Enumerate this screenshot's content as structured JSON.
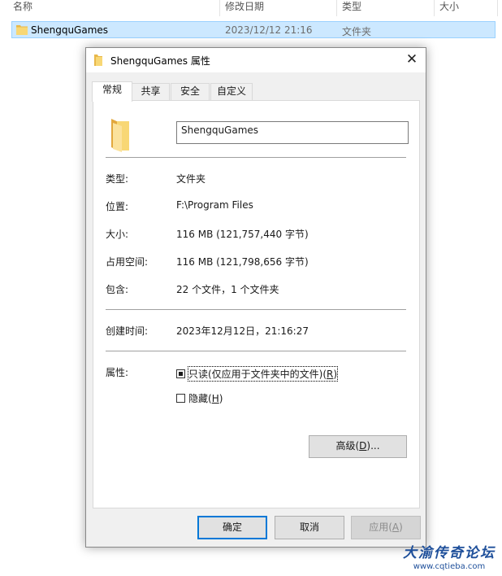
{
  "explorer": {
    "columns": [
      "名称",
      "修改日期",
      "类型",
      "大小"
    ],
    "row": {
      "name": "ShengquGames",
      "date": "2023/12/12 21:16",
      "type": "文件夹",
      "icon": "folder-icon"
    }
  },
  "dialog": {
    "title": "ShengquGames 属性",
    "close_glyph": "✕",
    "tabs": [
      "常规",
      "共享",
      "安全",
      "自定义"
    ],
    "active_tab": "常规",
    "name_value": "ShengquGames",
    "fields": [
      {
        "label": "类型:",
        "value": "文件夹"
      },
      {
        "label": "位置:",
        "value": "F:\\Program Files"
      },
      {
        "label": "大小:",
        "value": "116 MB (121,757,440 字节)"
      },
      {
        "label": "占用空间:",
        "value": "116 MB (121,798,656 字节)"
      },
      {
        "label": "包含:",
        "value": "22 个文件，1 个文件夹"
      }
    ],
    "created": {
      "label": "创建时间:",
      "value": "2023年12月12日，21:16:27"
    },
    "attributes": {
      "label": "属性:",
      "readonly": {
        "text": "只读(仅应用于文件夹中的文件)(",
        "key": "R",
        "end": ")",
        "state": "indeterminate"
      },
      "hidden": {
        "text": "隐藏(",
        "key": "H",
        "end": ")",
        "checked": false
      },
      "advanced": {
        "text": "高级(",
        "key": "D",
        "end": ")..."
      }
    },
    "buttons": {
      "ok": "确定",
      "cancel": "取消",
      "apply": {
        "text": "应用(",
        "key": "A",
        "end": ")"
      }
    }
  },
  "watermark": {
    "title": "大渝传奇论坛",
    "url": "www.cqtieba.com"
  },
  "colors": {
    "selection": "#cce8ff",
    "accent": "#0078d7",
    "folder": "#f8d775"
  }
}
